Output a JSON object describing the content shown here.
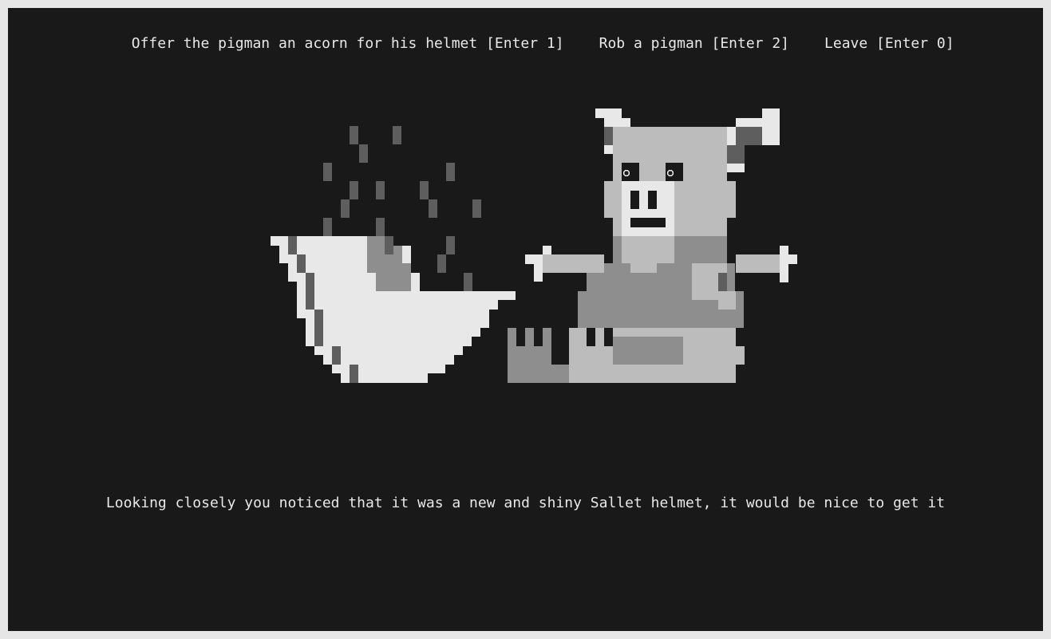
{
  "options": [
    {
      "label": "Offer the pigman an acorn for his helmet [Enter 1]"
    },
    {
      "label": "Rob a pigman [Enter 2]"
    },
    {
      "label": "Leave [Enter 0]"
    }
  ],
  "message": "Looking closely you noticed that it was a new and shiny Sallet helmet, it would be nice to get it",
  "palette": {
    "background": "#191919",
    "frame": "#e6e6e6",
    "text": "#e8e8e8",
    "white": "#e8e8e8",
    "light_gray": "#bcbcbc",
    "mid_gray": "#8e8e8e",
    "dark_gray": "#5e5e5e",
    "black": "#191919"
  },
  "scene": {
    "left_object": "helmet-icon",
    "right_object": "pigman-icon"
  }
}
